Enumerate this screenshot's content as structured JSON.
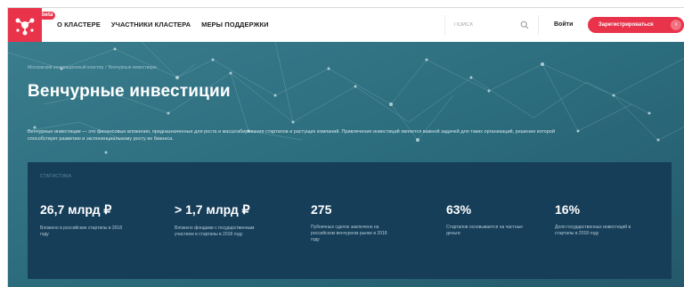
{
  "header": {
    "beta_badge": "beta",
    "nav": [
      "О КЛАСТЕРЕ",
      "УЧАСТНИКИ КЛАСТЕРА",
      "МЕРЫ ПОДДЕРЖКИ"
    ],
    "search": {
      "placeholder": "ПОИСК"
    },
    "login_label": "Войти",
    "register_label": "Зарегистрироваться",
    "brand_color": "#e8334b"
  },
  "hero": {
    "breadcrumb": [
      "Московский инновационный кластер",
      "Венчурные инвестиции"
    ],
    "breadcrumb_separator": "/",
    "title": "Венчурные инвестиции",
    "description": "Венчурные инвестиции — это финансовые вложения, предназначенные для роста и масштабирования стартапов и растущих компаний. Привлечение инвестиций является важной задачей для таких организаций, решение которой способствует развитию и экспоненциальному росту их бизнеса.",
    "background_color": "#2c6f80"
  },
  "stats": {
    "label": "СТАТИСТИКА",
    "background_color": "#163e59",
    "items": [
      {
        "value": "26,7 млрд ₽",
        "desc": "Вложено в российские стартапы в 2018 году"
      },
      {
        "value": "> 1,7 млрд ₽",
        "desc": "Вложено фондами с государственным участием в стартапы в 2018 году"
      },
      {
        "value": "275",
        "desc": "Публичных сделок заключено на российском венчурном рынке в 2018 году"
      },
      {
        "value": "63%",
        "desc": "Стартапов основывается на частные деньги"
      },
      {
        "value": "16%",
        "desc": "Доля государственных инвестиций в стартапы в 2018 году"
      }
    ]
  }
}
